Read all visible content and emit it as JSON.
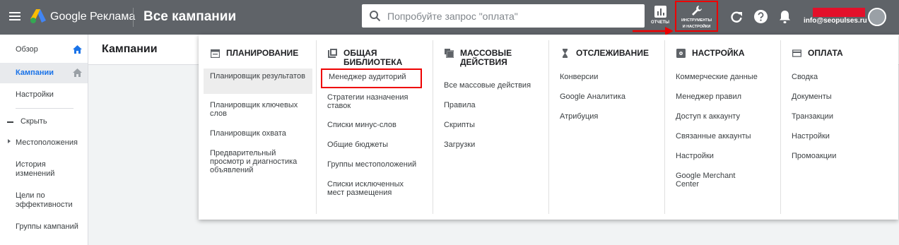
{
  "header": {
    "brand": "Google Реклама",
    "page_title": "Все кампании",
    "search_placeholder": "Попробуйте запрос \"оплата\"",
    "reports_label": "ОТЧЕТЫ",
    "tools_label_1": "ИНСТРУМЕНТЫ",
    "tools_label_2": "И НАСТРОЙКИ",
    "account_email": "info@seopulses.ru",
    "icons": [
      "menu-icon",
      "google-ads-logo",
      "search-icon",
      "bar-chart-icon",
      "wrench-icon",
      "refresh-icon",
      "help-icon",
      "bell-icon",
      "avatar"
    ]
  },
  "sidebar": {
    "items": [
      {
        "label": "Обзор"
      },
      {
        "label": "Кампании"
      },
      {
        "label": "Настройки"
      },
      {
        "label": "Скрыть"
      },
      {
        "label": "Местоположения"
      },
      {
        "label": "История изменений"
      },
      {
        "label": "Цели по эффективности"
      },
      {
        "label": "Группы кампаний"
      }
    ]
  },
  "main": {
    "title": "Кампании"
  },
  "menu": {
    "columns": [
      {
        "title": "ПЛАНИРОВАНИЕ",
        "icon": "calendar-icon",
        "items": [
          "Планировщик результатов",
          "Планировщик ключевых слов",
          "Планировщик охвата",
          "Предварительный просмотр и диагностика объявлений"
        ]
      },
      {
        "title": "ОБЩАЯ БИБЛИОТЕКА",
        "icon": "library-icon",
        "items": [
          "Менеджер аудиторий",
          "Стратегии назначения ставок",
          "Списки минус-слов",
          "Общие бюджеты",
          "Группы местоположений",
          "Списки исключенных мест размещения"
        ]
      },
      {
        "title": "МАССОВЫЕ ДЕЙСТВИЯ",
        "icon": "copy-icon",
        "items": [
          "Все массовые действия",
          "Правила",
          "Скрипты",
          "Загрузки"
        ]
      },
      {
        "title": "ОТСЛЕЖИВАНИЕ",
        "icon": "hourglass-icon",
        "items": [
          "Конверсии",
          "Google Аналитика",
          "Атрибуция"
        ]
      },
      {
        "title": "НАСТРОЙКА",
        "icon": "settings-box-icon",
        "items": [
          "Коммерческие данные",
          "Менеджер правил",
          "Доступ к аккаунту",
          "Связанные аккаунты",
          "Настройки",
          "Google Merchant Center"
        ]
      },
      {
        "title": "ОПЛАТА",
        "icon": "credit-card-icon",
        "items": [
          "Сводка",
          "Документы",
          "Транзакции",
          "Настройки",
          "Промоакции"
        ]
      }
    ]
  },
  "colors": {
    "topbar": "#5f6368",
    "accent": "#1a73e8",
    "highlight_box": "#e00000"
  }
}
